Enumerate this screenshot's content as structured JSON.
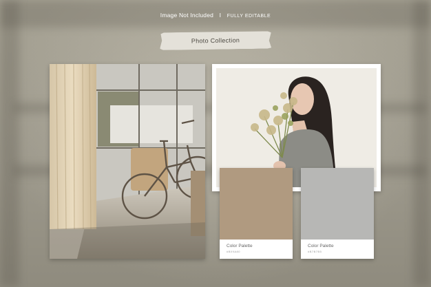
{
  "header": {
    "left_text": "Image Not Included",
    "separator": "I",
    "right_text": "Fully Editable"
  },
  "tape_label": "Photo Collection",
  "swatches": [
    {
      "label": "Color Palette",
      "code": "#B09A80",
      "color": "#b09a80"
    },
    {
      "label": "Color Palette",
      "code": "#B7B7B5",
      "color": "#b7b7b5"
    }
  ],
  "colors": {
    "background": "#9b978a",
    "tape": "#e4e1d9"
  }
}
